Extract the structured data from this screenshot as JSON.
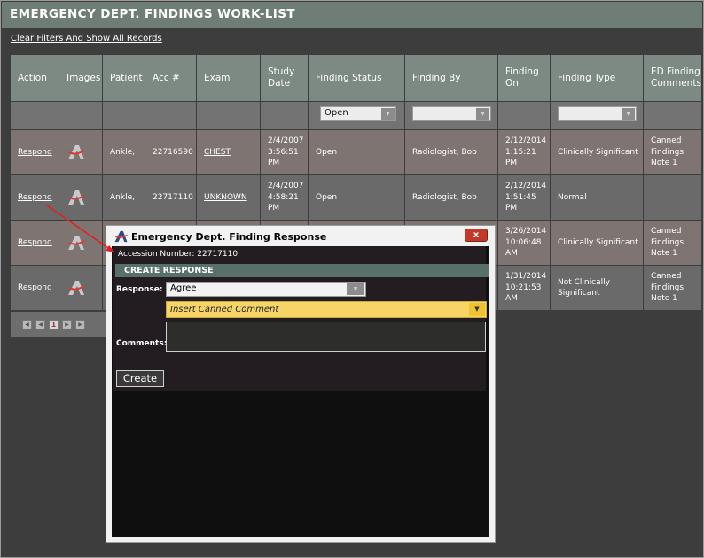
{
  "app": {
    "title": "EMERGENCY DEPT. FINDINGS WORK-LIST",
    "clear_filters_link": "Clear Filters And Show All Records"
  },
  "columns": [
    {
      "key": "action",
      "label": "Action"
    },
    {
      "key": "images",
      "label": "Images"
    },
    {
      "key": "patient",
      "label": "Patient"
    },
    {
      "key": "acc",
      "label": "Acc #"
    },
    {
      "key": "exam",
      "label": "Exam"
    },
    {
      "key": "study_date",
      "label": "Study Date"
    },
    {
      "key": "finding_status",
      "label": "Finding Status"
    },
    {
      "key": "finding_by",
      "label": "Finding By"
    },
    {
      "key": "finding_on",
      "label": "Finding On"
    },
    {
      "key": "finding_type",
      "label": "Finding Type"
    },
    {
      "key": "ed_comments",
      "label": "ED Finding Comments"
    }
  ],
  "filters": {
    "finding_status": "Open"
  },
  "rows": [
    {
      "action": "Respond",
      "patient": "Ankle,",
      "acc": "22716590",
      "exam": "CHEST",
      "study_date": "2/4/2007 3:56:51 PM",
      "finding_status": "Open",
      "finding_by": "Radiologist, Bob",
      "finding_on": "2/12/2014 1:15:21 PM",
      "finding_type": "Clinically Significant",
      "ed_comments": "Canned Findings Note 1"
    },
    {
      "action": "Respond",
      "patient": "Ankle,",
      "acc": "22717110",
      "exam": "UNKNOWN",
      "study_date": "2/4/2007 4:58:21 PM",
      "finding_status": "Open",
      "finding_by": "Radiologist, Bob",
      "finding_on": "2/12/2014 1:51:45 PM",
      "finding_type": "Normal",
      "ed_comments": ""
    },
    {
      "action": "Respond",
      "patient": "",
      "acc": "",
      "exam": "",
      "study_date": "",
      "finding_status": "",
      "finding_by": "",
      "finding_on": "3/26/2014 10:06:48 AM",
      "finding_type": "Clinically Significant",
      "ed_comments": "Canned Findings Note 1"
    },
    {
      "action": "Respond",
      "patient": "",
      "acc": "",
      "exam": "",
      "study_date": "",
      "finding_status": "",
      "finding_by": "",
      "finding_on": "1/31/2014 10:21:53 AM",
      "finding_type": "Not Clinically Significant",
      "ed_comments": "Canned Findings Note 1"
    }
  ],
  "pager": {
    "current_page": "1"
  },
  "dialog": {
    "title": "Emergency Dept. Finding Response",
    "close_label": "x",
    "accession": "Accession Number: 22717110",
    "section_header": "CREATE RESPONSE",
    "response_label": "Response:",
    "response_value": "Agree",
    "canned_placeholder": "Insert Canned Comment",
    "comments_label": "Comments:",
    "comments_value": "",
    "create_button": "Create"
  },
  "colors": {
    "header_bar": "#6e7d76",
    "column_header": "#7c8a83",
    "row_bg": "#7e7572",
    "row_alt_bg": "#6a6a6a",
    "canned_highlight": "#f6d468",
    "close_red": "#c0392b",
    "arrow_red": "#e02020"
  }
}
